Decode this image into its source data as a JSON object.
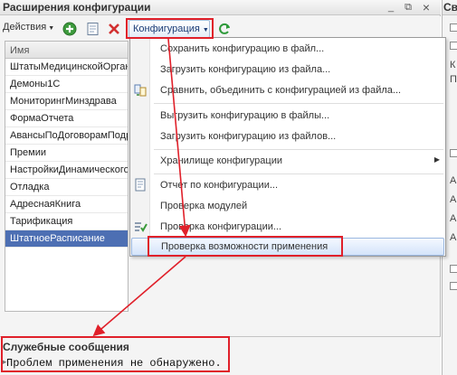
{
  "window": {
    "title": "Расширения конфигурации",
    "minimize_label": "_",
    "restore_label": "⧉",
    "close_label": "×"
  },
  "toolbar": {
    "actions_label": "Действия",
    "config_label": "Конфигурация"
  },
  "grid": {
    "column_header": "Имя",
    "rows": [
      "ШтатыМедицинскойОрганизации",
      "Демоны1С",
      "МониторингМинздрава",
      "ФормаОтчета",
      "АвансыПоДоговорамПодряда",
      "Премии",
      "НастройкиДинамическогоСписка",
      "Отладка",
      "АдреснаяКнига",
      "Тарификация",
      "ШтатноеРасписание"
    ],
    "selected_row": "ШтатноеРасписание"
  },
  "menu": {
    "items": [
      {
        "label": "Сохранить конфигурацию в файл..."
      },
      {
        "label": "Загрузить конфигурацию из файла..."
      },
      {
        "label": "Сравнить, объединить с конфигурацией из файла..."
      },
      {
        "label": "Выгрузить конфигурацию в файлы..."
      },
      {
        "label": "Загрузить конфигурацию из файлов..."
      },
      {
        "label": "Хранилище конфигурации"
      },
      {
        "label": "Отчет по конфигурации..."
      },
      {
        "label": "Проверка модулей"
      },
      {
        "label": "Проверка конфигурации..."
      },
      {
        "label": "Проверка возможности применения"
      }
    ],
    "highlighted_item": "Проверка возможности применения"
  },
  "messages": {
    "title": "Служебные сообщения",
    "text": "Проблем применения не обнаружено."
  },
  "right_panel": {
    "header_fragment": "Св",
    "letters": [
      "К",
      "П",
      "А",
      "А",
      "А",
      "А"
    ]
  },
  "colors": {
    "annotation": "#e0202a",
    "selection": "#4d6fb3",
    "menu_highlight": "#d4e4fa"
  }
}
